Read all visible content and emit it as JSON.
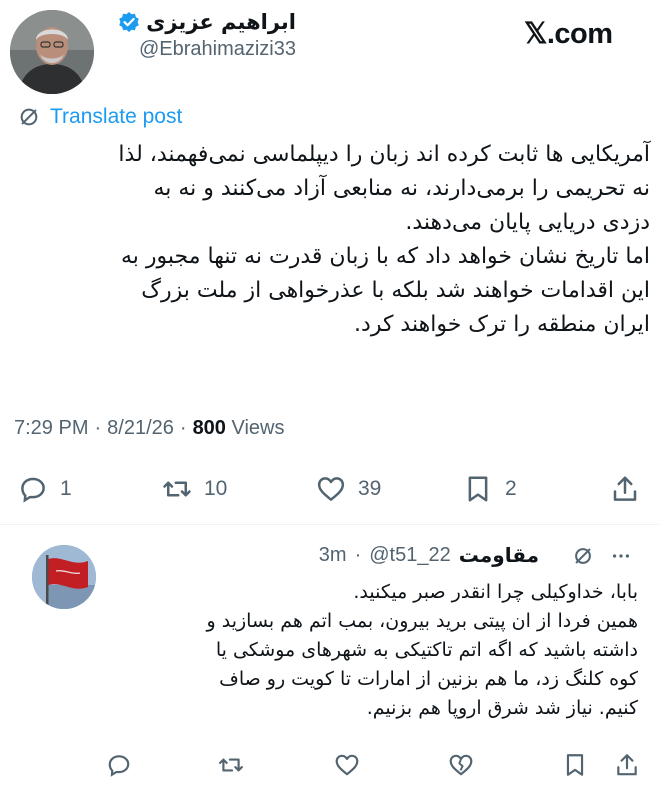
{
  "brand": "𝕏.com",
  "post": {
    "author_name": "ابراهیم عزیزی",
    "author_handle": "@Ebrahimazizi33",
    "verified": true,
    "translate_label": "Translate post",
    "lines": [
      "آمریکایی ها ثابت کرده اند زبان را دیپلماسی نمی‌فهمند، لذا",
      "نه تحریمی را برمی‌دارند، نه منابعی آزاد می‌کنند و نه به",
      "دزدی دریایی پایان می‌دهند.",
      "اما تاریخ نشان خواهد داد که با زبان قدرت نه تنها مجبور به",
      "این اقدامات خواهند شد بلکه با عذرخواهی از ملت بزرگ",
      "ایران منطقه را ترک خواهند کرد."
    ],
    "time": "7:29 PM",
    "date": "8/21/26",
    "views_count": "800",
    "views_label": "Views",
    "separator": "·",
    "replies": "1",
    "reposts": "10",
    "likes": "39",
    "bookmarks": "2"
  },
  "reply": {
    "author_name": "مقاومت",
    "handle": "@t51_22",
    "separator": "·",
    "time": "3m",
    "lines": [
      "بابا، خداوکیلی چرا انقدر صبر میکنید.",
      "همین فردا از ان پیتی برید بیرون، بمب اتم هم بسازید و",
      "داشته باشید که اگه اتم تاکتیکی به شهرهای موشکی یا",
      "کوه کلنگ زد، ما هم بزنین از امارات تا کویت رو صاف",
      "کنیم. نیاز شد شرق اروپا هم بزنیم."
    ]
  },
  "colors": {
    "accent": "#1d9bf0",
    "muted": "#536471",
    "text": "#0f1419"
  }
}
